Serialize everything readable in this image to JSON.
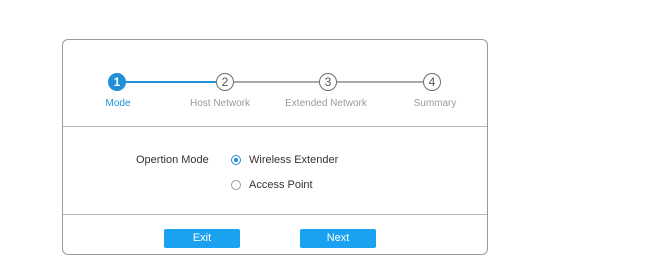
{
  "wizard": {
    "steps": [
      {
        "number": "1",
        "label": "Mode",
        "active": true
      },
      {
        "number": "2",
        "label": "Host Network",
        "active": false
      },
      {
        "number": "3",
        "label": "Extended Network",
        "active": false
      },
      {
        "number": "4",
        "label": "Summary",
        "active": false
      }
    ]
  },
  "form": {
    "mode_label": "Opertion Mode",
    "options": [
      {
        "label": "Wireless Extender",
        "selected": true
      },
      {
        "label": "Access Point",
        "selected": false
      }
    ]
  },
  "buttons": {
    "exit_label": "Exit",
    "next_label": "Next"
  },
  "colors": {
    "accent": "#1f8fd8",
    "button": "#1aa2f0",
    "inactive": "#a9a9a9"
  }
}
